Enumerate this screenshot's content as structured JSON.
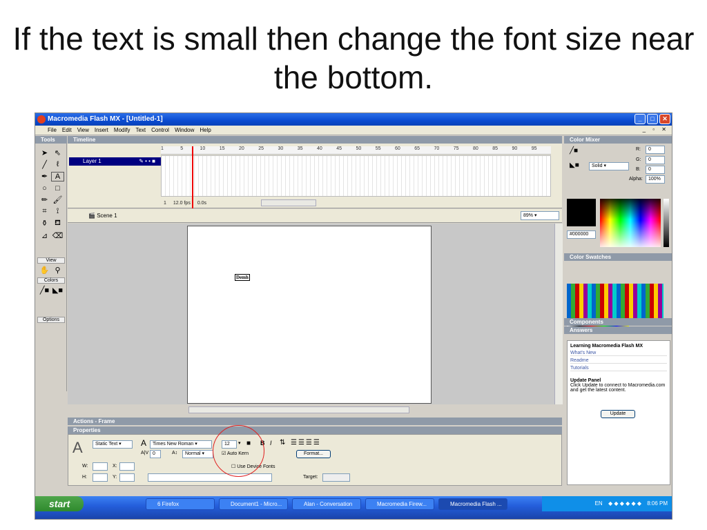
{
  "slide": {
    "title": "If the text is small then change the font size near the bottom."
  },
  "window": {
    "title": "Macromedia Flash MX - [Untitled-1]"
  },
  "menu": [
    "File",
    "Edit",
    "View",
    "Insert",
    "Modify",
    "Text",
    "Control",
    "Window",
    "Help"
  ],
  "tools": {
    "header": "Tools",
    "view_label": "View",
    "colors_label": "Colors",
    "options_label": "Options"
  },
  "timeline": {
    "header": "Timeline",
    "layer_name": "Layer 1",
    "frame_numbers": [
      "1",
      "5",
      "10",
      "15",
      "20",
      "25",
      "30",
      "35",
      "40",
      "45",
      "50",
      "55",
      "60",
      "65",
      "70",
      "75",
      "80",
      "85",
      "90",
      "95"
    ],
    "current_frame": "1",
    "fps": "12.0 fps",
    "time": "0.0s"
  },
  "scene": {
    "name": "Scene 1",
    "zoom": "89%"
  },
  "stage": {
    "text": "Demh"
  },
  "panels": {
    "actions": "Actions - Frame",
    "properties": "Properties"
  },
  "properties": {
    "text_type": "Static Text",
    "font": "Times New Roman",
    "font_size": "12",
    "tracking": "0",
    "baseline": "Normal",
    "autokern": "Auto Kern",
    "format_button": "Format...",
    "use_device_fonts": "Use Device Fonts",
    "w_label": "W:",
    "h_label": "H:",
    "x_label": "X:",
    "y_label": "Y:",
    "target_label": "Target:"
  },
  "color_mixer": {
    "header": "Color Mixer",
    "fill_style": "Solid",
    "r_label": "R:",
    "r": "0",
    "g_label": "G:",
    "g": "0",
    "b_label": "B:",
    "b": "0",
    "alpha_label": "Alpha:",
    "alpha": "100%",
    "hex": "#000000"
  },
  "color_swatches": {
    "header": "Color Swatches"
  },
  "components": {
    "header": "Components"
  },
  "answers": {
    "header": "Answers",
    "title": "Learning Macromedia Flash MX",
    "links": [
      "What's New",
      "Readme",
      "Tutorials"
    ],
    "update_title": "Update Panel",
    "update_text": "Click Update to connect to Macromedia.com and get the latest content.",
    "update_button": "Update"
  },
  "taskbar": {
    "start": "start",
    "tasks": [
      "6 Firefox",
      "Document1 - Micro...",
      "Alan - Conversation",
      "Macromedia Firew...",
      "Macromedia Flash ..."
    ],
    "lang": "EN",
    "clock": "8:06 PM"
  },
  "colors": {
    "titlebar": "#0a4bd0",
    "taskbar": "#245edb",
    "start_green": "#2f8a2d",
    "callout": "#e02020"
  }
}
